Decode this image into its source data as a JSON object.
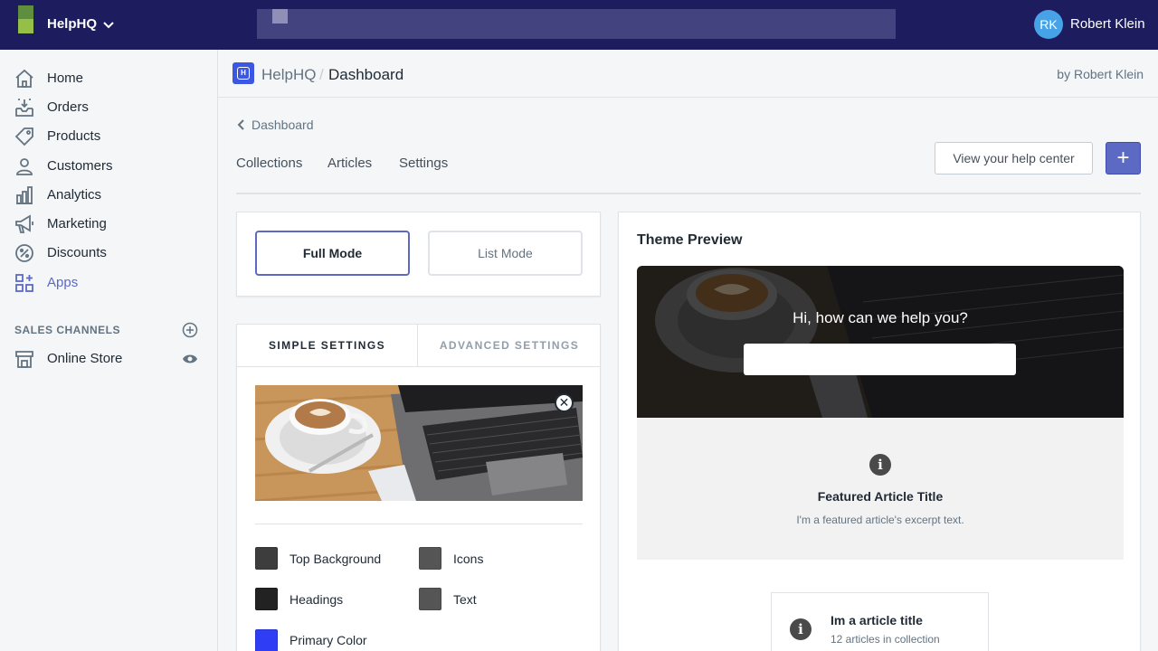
{
  "topbar": {
    "store_name": "HelpHQ",
    "user_initials": "RK",
    "user_name": "Robert Klein"
  },
  "sidebar": {
    "items": [
      {
        "label": "Home",
        "icon": "home-icon"
      },
      {
        "label": "Orders",
        "icon": "orders-icon"
      },
      {
        "label": "Products",
        "icon": "tag-icon"
      },
      {
        "label": "Customers",
        "icon": "person-icon"
      },
      {
        "label": "Analytics",
        "icon": "bar-chart-icon"
      },
      {
        "label": "Marketing",
        "icon": "megaphone-icon"
      },
      {
        "label": "Discounts",
        "icon": "discount-icon"
      },
      {
        "label": "Apps",
        "icon": "apps-icon",
        "active": true
      }
    ],
    "channels_title": "SALES CHANNELS",
    "channels": [
      {
        "label": "Online Store",
        "icon": "store-icon"
      }
    ]
  },
  "header": {
    "app_name": "HelpHQ",
    "separator": "/",
    "page_title": "Dashboard",
    "byline": "by Robert Klein"
  },
  "content": {
    "back_label": "Dashboard",
    "tabs": [
      "Collections",
      "Articles",
      "Settings"
    ],
    "view_button": "View your help center",
    "add_button": "+"
  },
  "modes": {
    "full": "Full Mode",
    "list": "List Mode"
  },
  "settings": {
    "tab_simple": "SIMPLE SETTINGS",
    "tab_advanced": "ADVANCED SETTINGS",
    "remove_icon": "close-icon",
    "colors": [
      {
        "label": "Top Background",
        "color": "#3d3d3d"
      },
      {
        "label": "Icons",
        "color": "#555555"
      },
      {
        "label": "Headings",
        "color": "#222222"
      },
      {
        "label": "Text",
        "color": "#555555"
      },
      {
        "label": "Primary Color",
        "color": "#2f3ef5"
      }
    ]
  },
  "preview": {
    "title": "Theme Preview",
    "hero_text": "Hi, how can we help you?",
    "featured_title": "Featured Article Title",
    "featured_excerpt": "I'm a featured article's excerpt text.",
    "article_title": "Im a article title",
    "article_meta": "12 articles in collection"
  },
  "colors": {
    "topbar": "#1c1c5e",
    "accent": "#5c6ac4",
    "app_icon": "#3c57e2"
  }
}
